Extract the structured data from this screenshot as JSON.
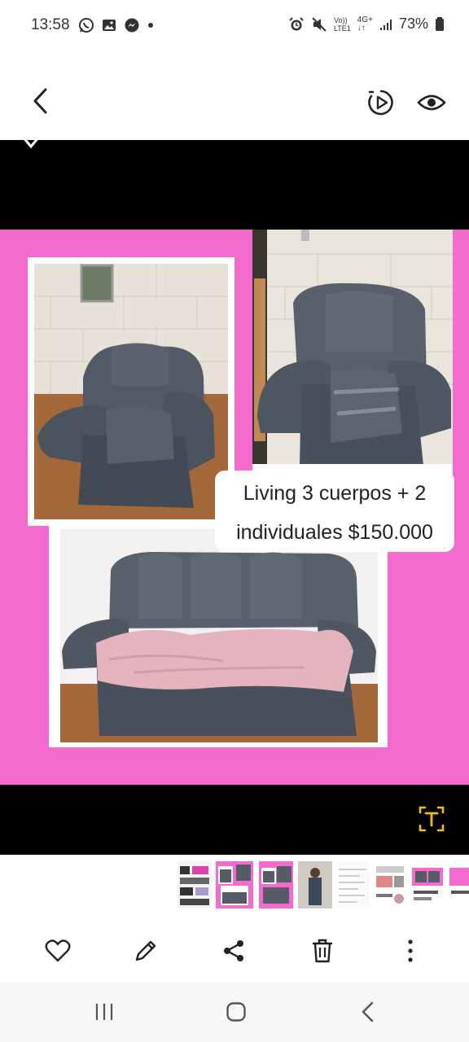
{
  "status": {
    "time": "13:58",
    "left_icons": [
      "whatsapp-icon",
      "gallery-icon",
      "messenger-icon",
      "dot-icon"
    ],
    "right_icons": [
      "alarm-icon",
      "mute-icon",
      "volte-icon",
      "4g-icon",
      "signal-icon"
    ],
    "network_top": "Vo))",
    "network_bottom": "LTE1",
    "net_type": "4G+",
    "battery": "73%"
  },
  "toolbar": {
    "back": "back-icon",
    "motion_photo": "motion-photo-icon",
    "view": "eye-icon"
  },
  "photo": {
    "caption_line1": "Living 3 cuerpos + 2",
    "caption_line2": "individuales $150.000",
    "bg_color": "#f46bd0",
    "text_extract": "text-extract-icon"
  },
  "thumbnails": {
    "count_visible": 8,
    "active_index": 1
  },
  "actions": {
    "favorite": "heart-icon",
    "edit": "pencil-icon",
    "share": "share-icon",
    "delete": "trash-icon",
    "more": "more-vertical-icon"
  },
  "nav": {
    "recents": "recents-icon",
    "home": "home-icon",
    "back": "back-nav-icon"
  }
}
